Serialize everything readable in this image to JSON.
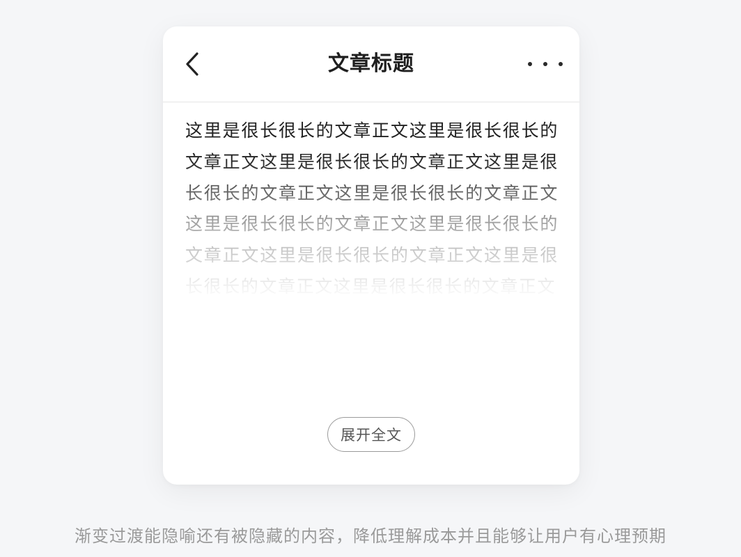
{
  "header": {
    "title": "文章标题",
    "back_icon": "chevron-left-icon",
    "more_icon": "more-horizontal-icon"
  },
  "article": {
    "body": "这里是很长很长的文章正文这里是很长很长的文章正文这里是很长很长的文章正文这里是很长很长的文章正文这里是很长很长的文章正文这里是很长很长的文章正文这里是很长很长的文章正文这里是很长很长的文章正文这里是很长很长的文章正文这里是很长很长的文章正文"
  },
  "expand_button": {
    "label": "展开全文"
  },
  "caption": "渐变过渡能隐喻还有被隐藏的内容，降低理解成本并且能够让用户有心理预期"
}
